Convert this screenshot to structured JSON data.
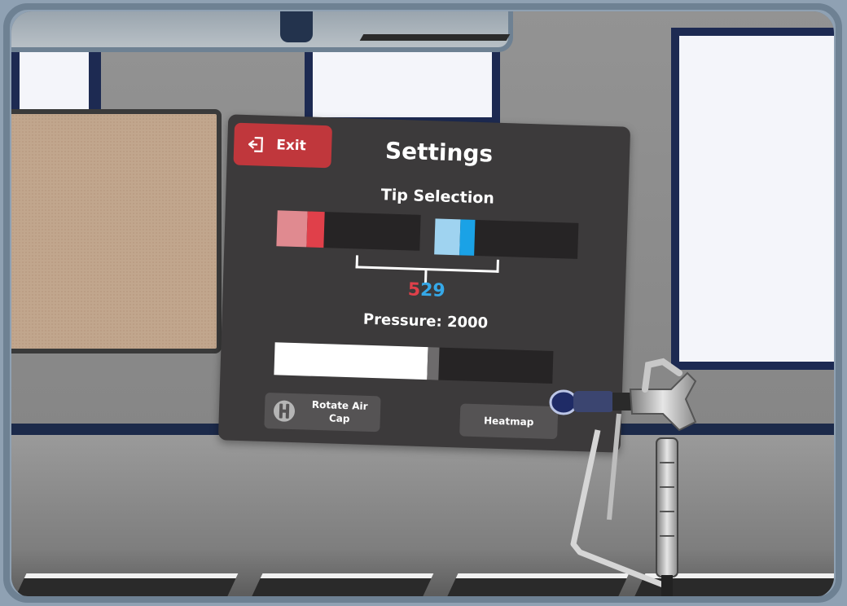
{
  "settings": {
    "exit_label": "Exit",
    "title": "Settings",
    "tip_selection_label": "Tip Selection",
    "tip_value": {
      "first_digit": "5",
      "rest_digits": "29",
      "first_color": "#e0404a",
      "rest_color": "#35a8e8"
    },
    "left_slider": {
      "level": 0.33,
      "light_color": "#e08a90",
      "dark_color": "#e0404a"
    },
    "right_slider": {
      "level": 0.28,
      "light_color": "#9fd3f0",
      "dark_color": "#1aa2e6"
    },
    "pressure_label": "Pressure: 2000",
    "pressure_level": 0.59,
    "rotate_air_cap_label": "Rotate Air Cap",
    "heatmap_label": "Heatmap"
  },
  "colors": {
    "panel_bg": "#3c3a3b",
    "exit_bg": "#c0373c",
    "button_bg": "#555354",
    "wall_frame": "#1d2a52"
  },
  "icons": {
    "exit": "exit-door-icon",
    "rotate": "air-cap-icon"
  }
}
